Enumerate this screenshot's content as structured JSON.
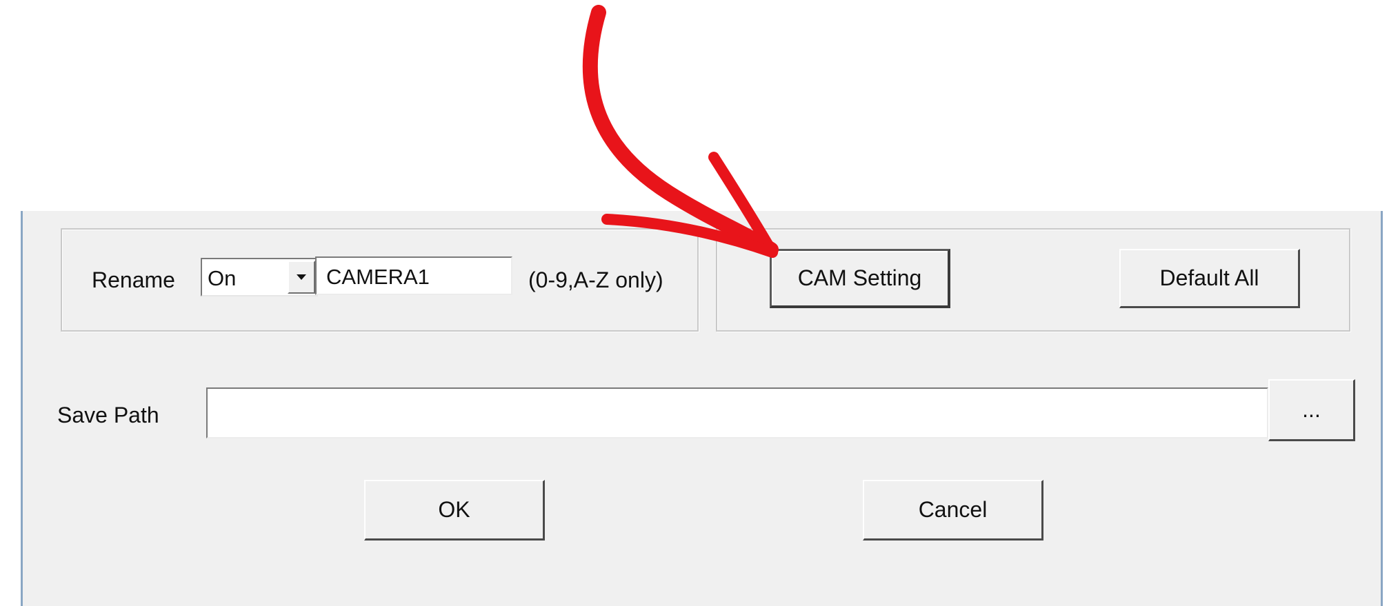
{
  "rename": {
    "label": "Rename",
    "mode_value": "On",
    "name_value": "CAMERA1",
    "hint": "(0-9,A-Z only)"
  },
  "buttons": {
    "cam_setting": "CAM Setting",
    "default_all": "Default All",
    "browse": "...",
    "ok": "OK",
    "cancel": "Cancel"
  },
  "save_path": {
    "label": "Save Path",
    "value": ""
  },
  "annotation": {
    "color": "#e8141a",
    "icon": "red-curved-arrow-icon"
  }
}
